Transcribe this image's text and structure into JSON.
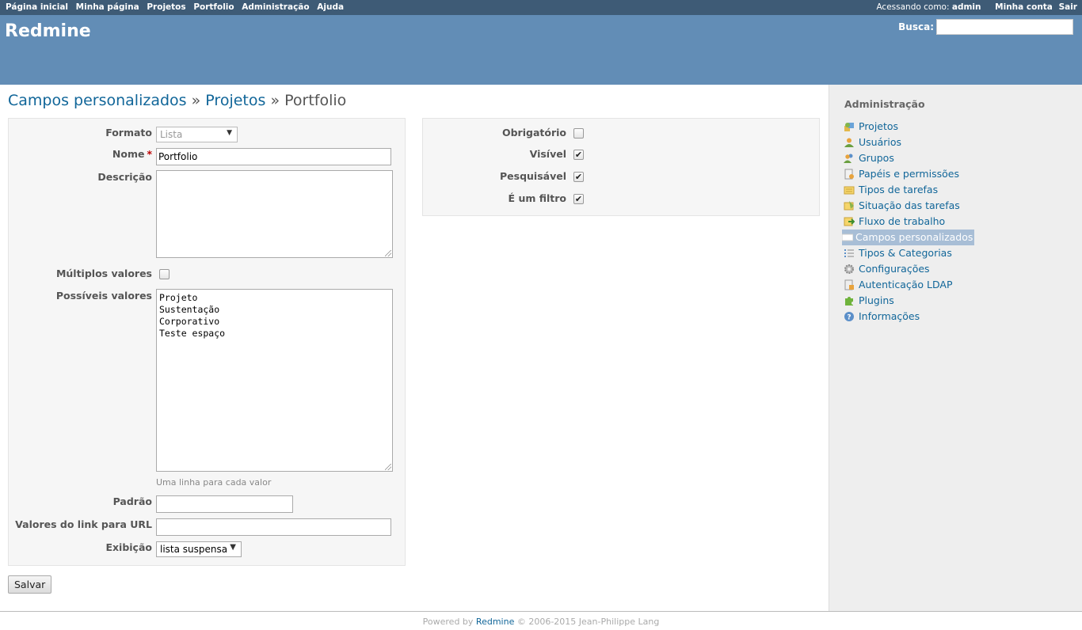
{
  "top_menu": {
    "items": [
      "Página inicial",
      "Minha página",
      "Projetos",
      "Portfolio",
      "Administração",
      "Ajuda"
    ],
    "logged_as_label": "Acessando como:",
    "logged_as_user": "admin",
    "my_account": "Minha conta",
    "logout": "Sair"
  },
  "header": {
    "title": "Redmine",
    "search_label": "Busca:",
    "search_value": ""
  },
  "breadcrumb": {
    "part1": "Campos personalizados",
    "sep1": "»",
    "part2": "Projetos",
    "sep2": "»",
    "current": "Portfolio"
  },
  "form": {
    "format_label": "Formato",
    "format_value": "Lista",
    "name_label": "Nome",
    "name_required": "*",
    "name_value": "Portfolio",
    "description_label": "Descrição",
    "description_value": "",
    "multiple_label": "Múltiplos valores",
    "multiple_checked": false,
    "possible_values_label": "Possíveis valores",
    "possible_values": [
      "Projeto",
      "Sustentação",
      "Corporativo",
      "Teste espaço"
    ],
    "possible_values_hint": "Uma linha para cada valor",
    "default_label": "Padrão",
    "default_value": "",
    "url_label": "Valores do link para URL",
    "url_value": "",
    "display_label": "Exibição",
    "display_value": "lista suspensa",
    "save_button": "Salvar"
  },
  "options": {
    "required_label": "Obrigatório",
    "required_checked": false,
    "visible_label": "Visível",
    "visible_checked": true,
    "searchable_label": "Pesquisável",
    "searchable_checked": true,
    "filter_label": "É um filtro",
    "filter_checked": true
  },
  "sidebar": {
    "title": "Administração",
    "items": [
      {
        "label": "Projetos",
        "icon": "projects-icon"
      },
      {
        "label": "Usuários",
        "icon": "user-icon"
      },
      {
        "label": "Grupos",
        "icon": "group-icon"
      },
      {
        "label": "Papéis e permissões",
        "icon": "roles-icon"
      },
      {
        "label": "Tipos de tarefas",
        "icon": "tracker-icon"
      },
      {
        "label": "Situação das tarefas",
        "icon": "issue-status-icon"
      },
      {
        "label": "Fluxo de trabalho",
        "icon": "workflow-icon"
      },
      {
        "label": "Campos personalizados",
        "icon": "custom-fields-icon",
        "selected": true
      },
      {
        "label": "Tipos & Categorias",
        "icon": "enumerations-icon"
      },
      {
        "label": "Configurações",
        "icon": "settings-icon"
      },
      {
        "label": "Autenticação LDAP",
        "icon": "ldap-icon"
      },
      {
        "label": "Plugins",
        "icon": "plugin-icon"
      },
      {
        "label": "Informações",
        "icon": "info-icon"
      }
    ]
  },
  "footer": {
    "powered_by": "Powered by",
    "redmine_link": "Redmine",
    "copyright": "© 2006-2015 Jean-Philippe Lang"
  }
}
